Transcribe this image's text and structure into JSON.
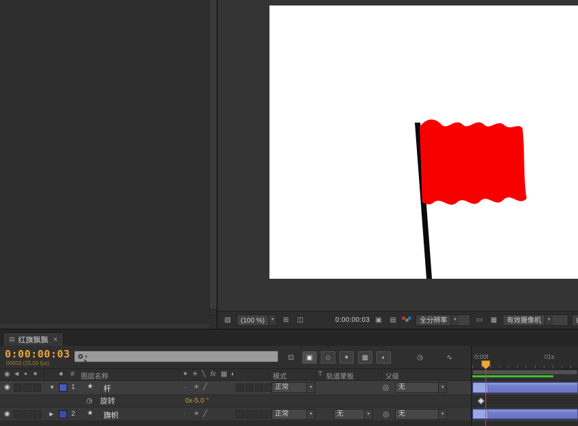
{
  "colors": {
    "flag_red": "#f80000",
    "timecode_orange": "#efa531",
    "property_value_yellow": "#cba136",
    "layer_bar_blue": "#7280cd",
    "render_bar_green": "#3ec22d",
    "layer_label_swatch": "#4a57c8"
  },
  "comp_toolbar": {
    "zoom_value": "(100 %)",
    "timecode": "0:00:00:03",
    "resolution_value": "全分辨率",
    "view_value": "有效摄像机"
  },
  "timeline": {
    "tab_title": "红旗飘飘",
    "close": "×",
    "timecode": "0:00:00:03",
    "frame_info": "00003 (25.00 fps)",
    "columns": {
      "hash": "#",
      "layer_name": "图层名称",
      "mode": "模式",
      "t": "T",
      "track_matte": "轨道蒙板",
      "parent": "父级"
    },
    "ruler_start": "0:00f",
    "ruler_end": "01s",
    "layers": [
      {
        "index": "1",
        "name": "杆",
        "mode": "正常",
        "parent": "无"
      },
      {
        "index": "2",
        "name": "旗帜",
        "mode": "正常",
        "track_matte": "无",
        "parent": "无"
      }
    ],
    "property": {
      "name": "旋转",
      "value": "0x-5.0 °"
    }
  },
  "icons": {
    "eye": "◉",
    "audio": "◀",
    "solo": "●",
    "lock": "■",
    "label_tag": "◆",
    "caret_down": "▼",
    "caret_right": "▶",
    "dd_arrow": "▼",
    "star": "★",
    "stopwatch": "◷",
    "parent_link": "◎",
    "hdr_shy": "✦",
    "hdr_sun": "☀",
    "hdr_quality": "╲",
    "hdr_fx": "fx",
    "hdr_blend": "▦",
    "hdr_blur": "◐",
    "row_dot": "·",
    "row_sun": "☀",
    "row_quality": "╱",
    "always_preview": "▧",
    "safe_zones": "⊞",
    "mask_visibility": "◫",
    "snapshot": "▣",
    "show_snapshot": "▤",
    "roi": "▭",
    "transparency_grid": "▦",
    "view_layout": "⊞",
    "mini_flowchart": "⊡",
    "live_update": "▣",
    "draft_3d": "◇",
    "hide_shy": "✦",
    "frame_blend_btn": "▦",
    "motion_blur_btn": "◐",
    "auto_keyframe": "◷",
    "graph_editor": "∿",
    "tab_panel": "▤",
    "search_arrow": "▾"
  }
}
